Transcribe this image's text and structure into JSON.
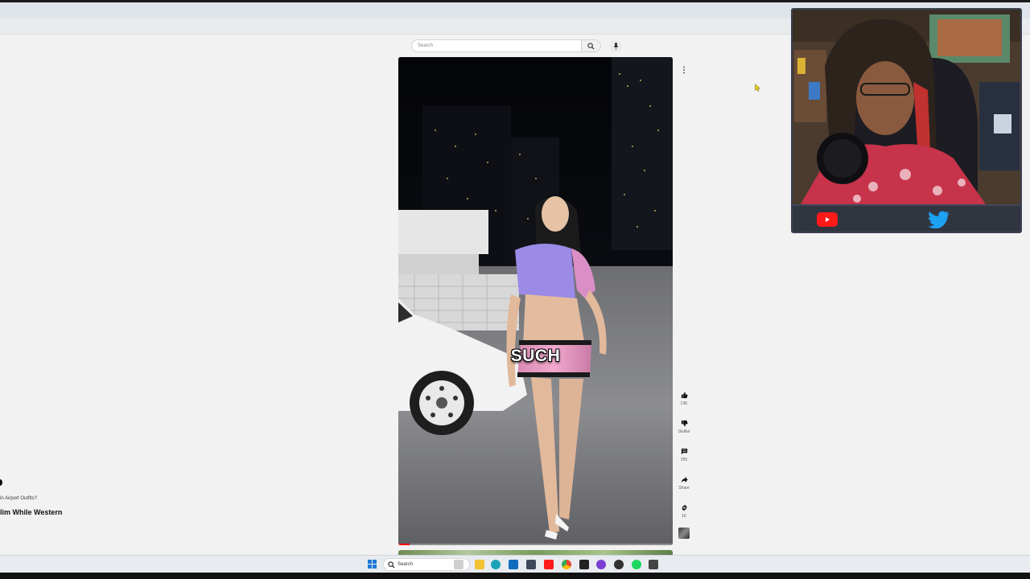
{
  "search": {
    "placeholder": "Search"
  },
  "video": {
    "caption": "SUCH",
    "progress_fraction": 0.04
  },
  "actions": {
    "like_count": "13K",
    "dislike_label": "Dislike",
    "comment_count": "255",
    "share_label": "Share",
    "remix_count": "1K"
  },
  "left_panel": {
    "faint_text": "",
    "subtitle": "in Airport Outfits?",
    "title": "lim While Western"
  },
  "taskbar": {
    "search_label": "Search"
  },
  "colors": {
    "youtube_red": "#ff1a1a",
    "twitter_blue": "#1da1f2",
    "windows_blue": "#1e78d7"
  },
  "icons": {
    "taskbar": [
      "windows-start-icon",
      "search-icon",
      "widgets-icon",
      "file-explorer-icon",
      "edge-browser-icon",
      "outlook-icon",
      "calculator-icon",
      "youtube-icon",
      "chrome-icon",
      "x-icon",
      "brave-icon",
      "obs-icon",
      "spotify-icon",
      "app-icon"
    ]
  }
}
